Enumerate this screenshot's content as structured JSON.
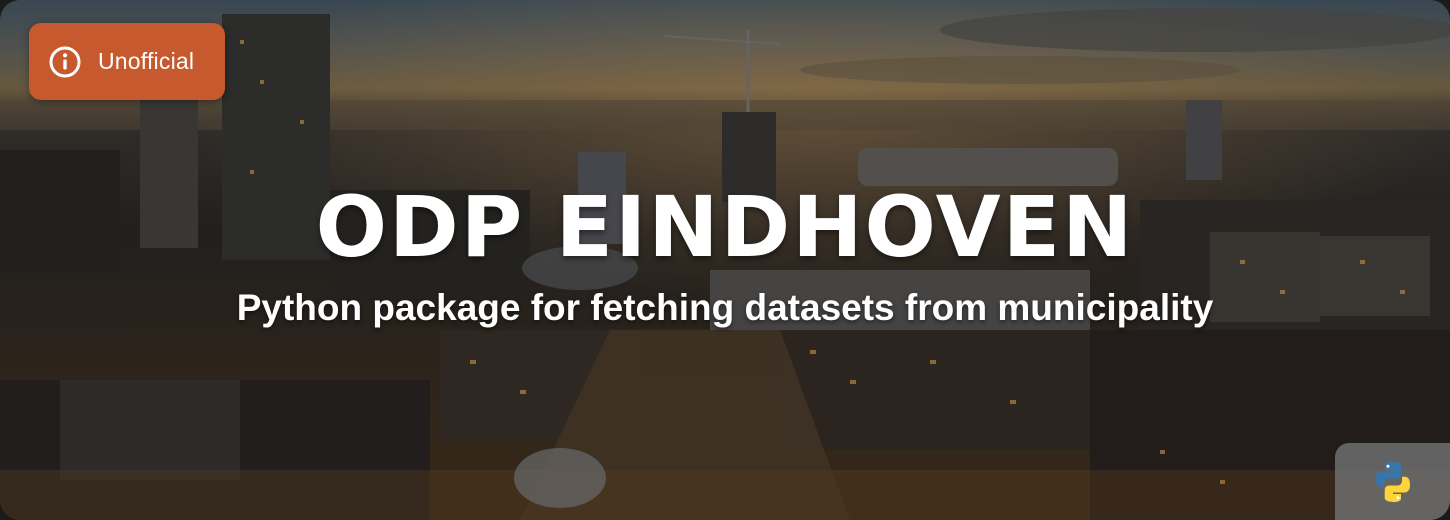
{
  "badge": {
    "label": "Unofficial",
    "icon": "info-icon"
  },
  "title": "ODP EINDHOVEN",
  "subtitle": "Python package for fetching datasets from municipality",
  "corner_icon": "python-logo-icon",
  "colors": {
    "badge": "#c65a2e",
    "text": "#ffffff",
    "python_blue": "#3776ab",
    "python_yellow": "#ffd43b"
  }
}
